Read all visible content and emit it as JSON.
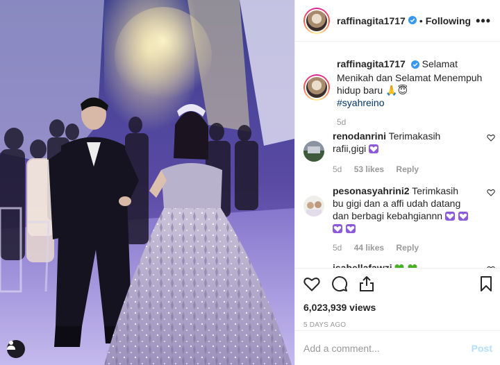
{
  "header": {
    "username": "raffinagita1717",
    "separator": "•",
    "follow_state": "Following",
    "more_glyph": "•••"
  },
  "caption": {
    "username": "raffinagita1717",
    "text": "Selamat Menikah dan Selamat Menempuh hidup baru 🙏😇",
    "hashtag": "#syahreino",
    "time": "5d"
  },
  "comments": [
    {
      "username": "renodanrini",
      "text": "Terimakasih rafii,gigi",
      "hearts": 1,
      "time": "5d",
      "likes": "53 likes",
      "reply": "Reply"
    },
    {
      "username": "pesonasyahrini2",
      "text": "Terimkasih bu gigi dan a affi udah datang dan berbagi kebahgiannn",
      "hearts": 4,
      "time": "5d",
      "likes": "44 likes",
      "reply": "Reply"
    },
    {
      "username": "isabellafawzi",
      "text": "",
      "hearts": 2
    }
  ],
  "actions": {
    "views": "6,023,939 views",
    "date": "5 DAYS AGO"
  },
  "add_comment": {
    "placeholder": "Add a comment...",
    "post_label": "Post"
  },
  "colors": {
    "verified_blue": "#3897f0",
    "purple_heart": "#8c5bd8",
    "green_heart": "#4caf2a",
    "post_disabled": "#b2dffc"
  },
  "icons": {
    "like": "heart-outline-icon",
    "comment": "speech-bubble-icon",
    "share": "share-upload-icon",
    "save": "bookmark-icon",
    "tag": "user-tag-icon"
  }
}
